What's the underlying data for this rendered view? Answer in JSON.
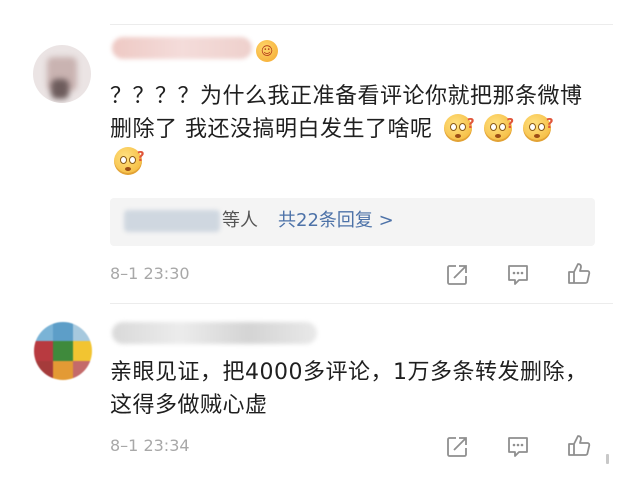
{
  "comments": [
    {
      "text": "？？？？为什么我正准备看评论你就把那条微博删除了 我还没搞明白发生了啥呢",
      "emoji_icon": "confused-face-emoji",
      "emoji_count": 4,
      "reply_summary": {
        "suffix": "等人",
        "link": "共22条回复 >"
      },
      "timestamp": "8–1 23:30",
      "actions": [
        "share-icon",
        "comment-icon",
        "like-icon"
      ]
    },
    {
      "text": "亲眼见证，把4000多评论，1万多条转发删除，这得多做贼心虚",
      "timestamp": "8–1 23:34",
      "actions": [
        "share-icon",
        "comment-icon",
        "like-icon"
      ]
    }
  ],
  "colors": {
    "text": "#1f1f1f",
    "meta": "#a8a8a8",
    "link": "#4d72a8",
    "reply_bg": "#f4f4f4",
    "icon": "#8f8f8f"
  }
}
